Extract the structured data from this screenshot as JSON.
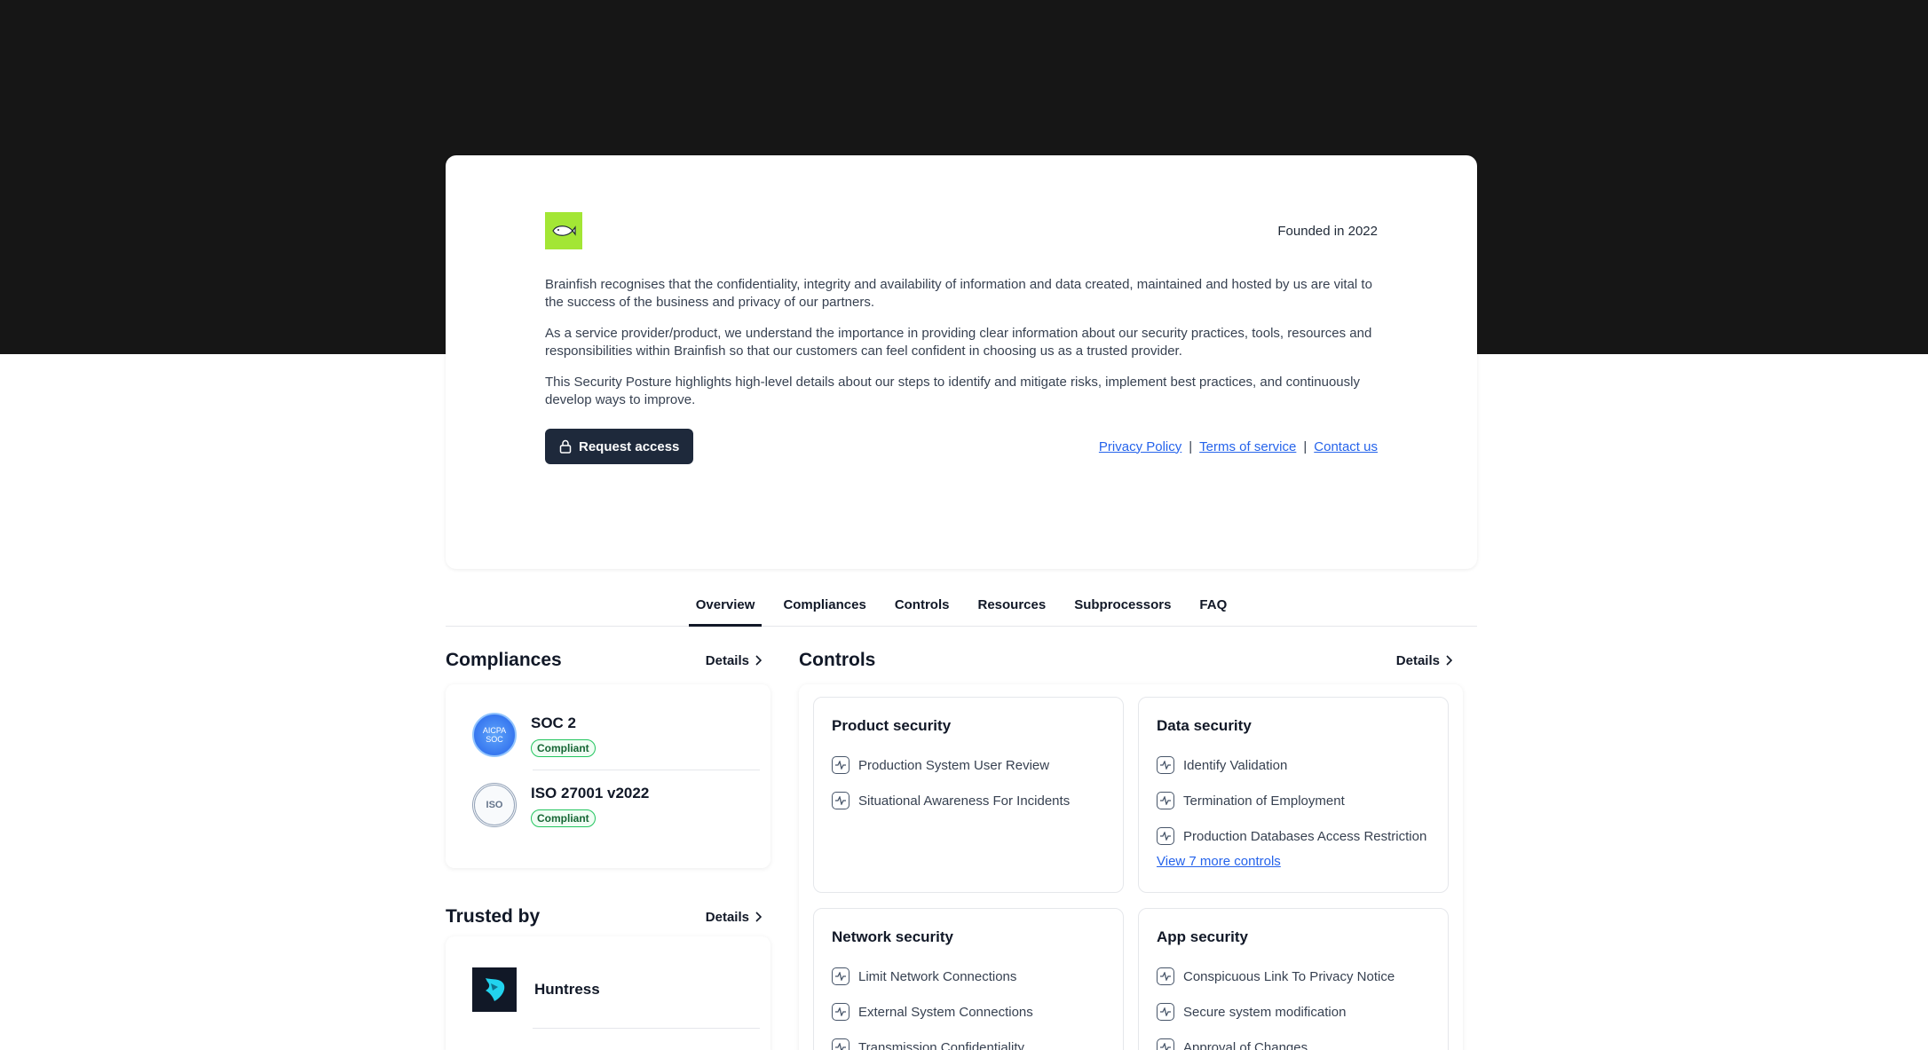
{
  "header": {
    "founded": "Founded in 2022"
  },
  "description": {
    "p1": "Brainfish recognises that the confidentiality, integrity and availability of information and data created, maintained and hosted by us are vital to the success of the business and privacy of our partners.",
    "p2": "As a service provider/product, we understand the importance in providing clear information about our security practices, tools, resources and responsibilities within Brainfish so that our customers can feel confident in choosing us as a trusted provider.",
    "p3": "This Security Posture highlights high-level details about our steps to identify and mitigate risks, implement best practices, and continuously develop ways to improve."
  },
  "actions": {
    "request_access": "Request access",
    "privacy_policy": "Privacy Policy",
    "terms": "Terms of service",
    "contact": "Contact us",
    "separator": "|"
  },
  "tabs": [
    {
      "label": "Overview",
      "active": true
    },
    {
      "label": "Compliances",
      "active": false
    },
    {
      "label": "Controls",
      "active": false
    },
    {
      "label": "Resources",
      "active": false
    },
    {
      "label": "Subprocessors",
      "active": false
    },
    {
      "label": "FAQ",
      "active": false
    }
  ],
  "compliances": {
    "title": "Compliances",
    "details": "Details",
    "items": [
      {
        "name": "SOC 2",
        "status": "Compliant",
        "icon_text": "AICPA SOC"
      },
      {
        "name": "ISO 27001 v2022",
        "status": "Compliant",
        "icon_text": "ISO"
      }
    ]
  },
  "trusted": {
    "title": "Trusted by",
    "details": "Details",
    "items": [
      {
        "name": "Huntress"
      }
    ]
  },
  "controls": {
    "title": "Controls",
    "details": "Details",
    "cards": [
      {
        "title": "Product security",
        "items": [
          "Production System User Review",
          "Situational Awareness For Incidents"
        ],
        "more": ""
      },
      {
        "title": "Data security",
        "items": [
          "Identify Validation",
          "Termination of Employment",
          "Production Databases Access Restriction"
        ],
        "more": "View 7 more controls"
      },
      {
        "title": "Network security",
        "items": [
          "Limit Network Connections",
          "External System Connections",
          "Transmission Confidentiality"
        ],
        "more": ""
      },
      {
        "title": "App security",
        "items": [
          "Conspicuous Link To Privacy Notice",
          "Secure system modification",
          "Approval of Changes"
        ],
        "more": ""
      }
    ]
  },
  "colors": {
    "hero_bg": "#161616",
    "brand_green": "#a3e635",
    "button_dark": "#1e293b",
    "link_blue": "#2563eb",
    "badge_green": "#22c55e"
  }
}
